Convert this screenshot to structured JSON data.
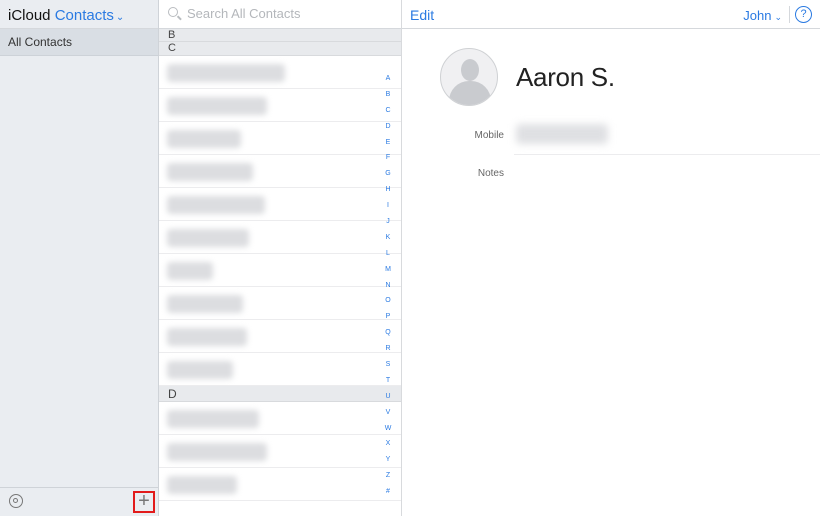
{
  "sidebar": {
    "app_name": "iCloud",
    "section_name": "Contacts",
    "groups": [
      "All Contacts"
    ]
  },
  "search": {
    "placeholder": "Search All Contacts"
  },
  "list": {
    "sections": [
      "B",
      "C",
      "D"
    ],
    "index_letters": [
      "A",
      "B",
      "C",
      "D",
      "E",
      "F",
      "G",
      "H",
      "I",
      "J",
      "K",
      "L",
      "M",
      "N",
      "O",
      "P",
      "Q",
      "R",
      "S",
      "T",
      "U",
      "V",
      "W",
      "X",
      "Y",
      "Z",
      "#"
    ]
  },
  "detail": {
    "edit_label": "Edit",
    "user_name": "John",
    "help_label": "?",
    "contact_name": "Aaron S.",
    "fields": {
      "mobile_label": "Mobile",
      "notes_label": "Notes"
    }
  },
  "colors": {
    "accent": "#2a7ae2",
    "highlight": "#e21b1b"
  }
}
